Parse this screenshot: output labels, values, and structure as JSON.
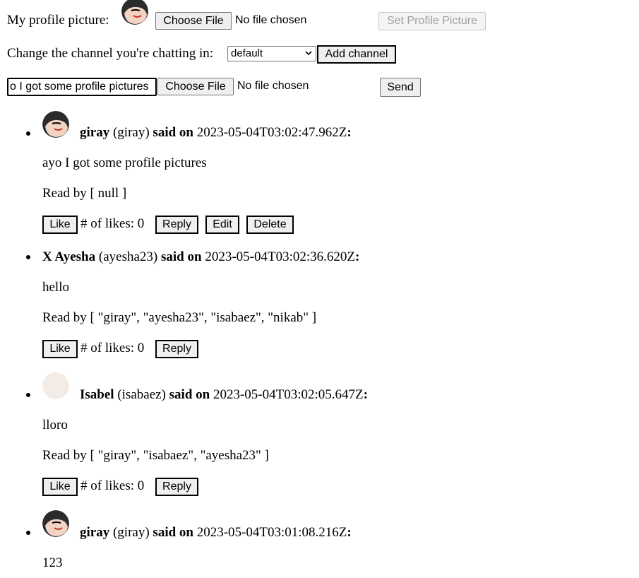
{
  "profile": {
    "label": "My profile picture:",
    "choose_file": "Choose File",
    "no_file": "No file chosen",
    "set_button": "Set Profile Picture"
  },
  "channel": {
    "label": "Change the channel you're chatting in:",
    "selected": "default",
    "add_button": "Add channel"
  },
  "composer": {
    "message_value": "o I got some profile pictures",
    "choose_file": "Choose File",
    "no_file": "No file chosen",
    "send_button": "Send"
  },
  "messages": [
    {
      "display_name": "giray",
      "username": "(giray)",
      "said_on": "said on",
      "timestamp": "2023-05-04T03:02:47.962Z",
      "colon": ":",
      "text": "ayo I got some profile pictures",
      "read_by": "Read by [ null ]",
      "like_label": "Like",
      "likes_text": "# of likes: 0",
      "reply_label": "Reply",
      "edit_label": "Edit",
      "delete_label": "Delete",
      "avatar": "cartoon-face-avatar"
    },
    {
      "display_name": "X Ayesha",
      "username": "(ayesha23)",
      "said_on": "said on",
      "timestamp": "2023-05-04T03:02:36.620Z",
      "colon": ":",
      "text": "hello",
      "read_by": "Read by [ \"giray\", \"ayesha23\", \"isabaez\", \"nikab\" ]",
      "like_label": "Like",
      "likes_text": "# of likes: 0",
      "reply_label": "Reply"
    },
    {
      "display_name": "Isabel",
      "username": "(isabaez)",
      "said_on": "said on",
      "timestamp": "2023-05-04T03:02:05.647Z",
      "colon": ":",
      "text": "lloro",
      "read_by": "Read by [ \"giray\", \"isabaez\", \"ayesha23\" ]",
      "like_label": "Like",
      "likes_text": "# of likes: 0",
      "reply_label": "Reply",
      "avatar": "blank-beige-avatar"
    },
    {
      "display_name": "giray",
      "username": "(giray)",
      "said_on": "said on",
      "timestamp": "2023-05-04T03:01:08.216Z",
      "colon": ":",
      "text": "123",
      "avatar": "cartoon-face-avatar"
    }
  ]
}
